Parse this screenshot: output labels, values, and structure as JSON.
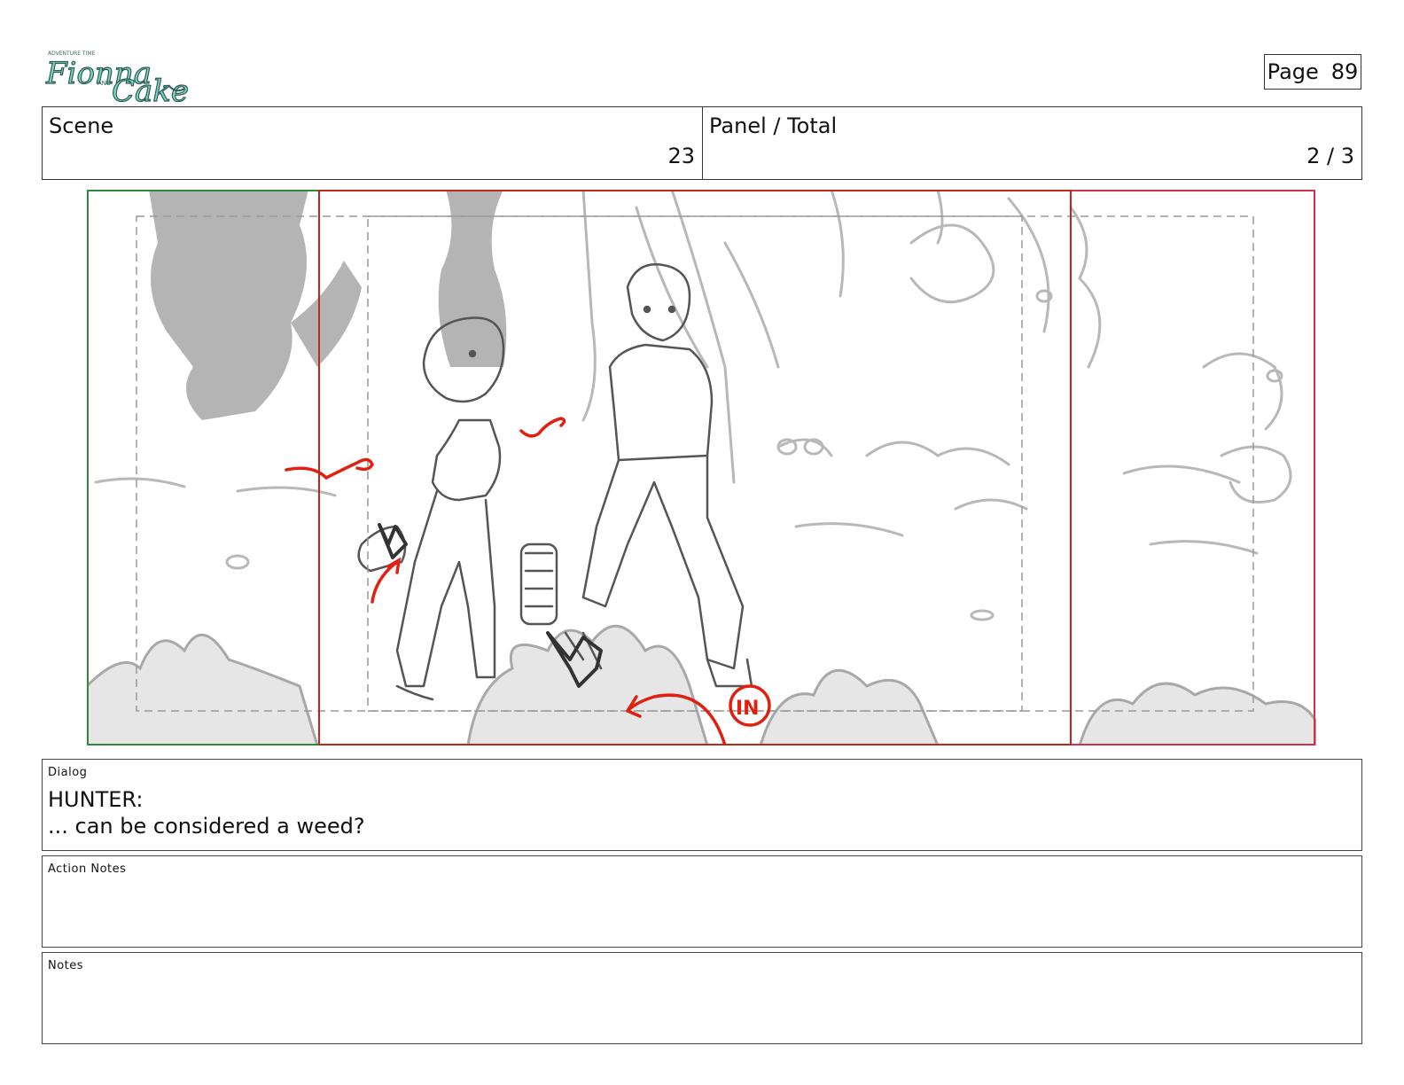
{
  "header": {
    "logo_text": "Fionna and Cake",
    "page_label": "Page",
    "page_number": "89"
  },
  "info": {
    "scene_label": "Scene",
    "scene_value": "23",
    "panel_label": "Panel / Total",
    "panel_value": "2 / 3"
  },
  "panel_image": {
    "marker_text": "IN",
    "colors": {
      "outer_frame": "#2e8b3c",
      "camera_frame": "#c0281c",
      "pan_end_frame": "#d0304a",
      "safe_area": "#999999",
      "annotation": "#e02010",
      "sketch_line": "#555555",
      "shadow_fill": "#b4b4b4"
    }
  },
  "dialog": {
    "label": "Dialog",
    "speaker": "HUNTER:",
    "line": "... can be considered a weed?"
  },
  "action_notes": {
    "label": "Action Notes",
    "text": ""
  },
  "notes": {
    "label": "Notes",
    "text": ""
  }
}
